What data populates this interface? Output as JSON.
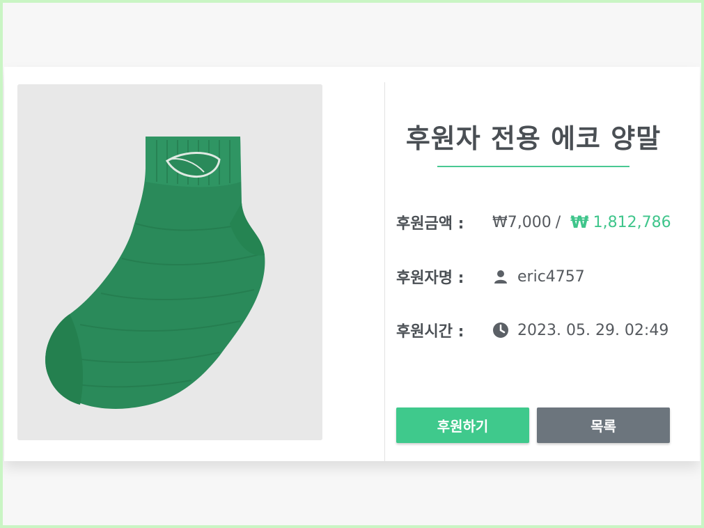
{
  "product": {
    "title": "후원자 전용 에코 양말",
    "image_icon": "green-ankle-sock-image"
  },
  "details": {
    "amount_label": "후원금액 :",
    "amount_value": "₩7,000",
    "amount_sep": "/",
    "total_icon": "won-icon",
    "total_symbol": "₩",
    "total_value": "1,812,786",
    "name_label": "후원자명 :",
    "name_icon": "user-icon",
    "name_value": "eric4757",
    "time_label": "후원시간 :",
    "time_icon": "clock-icon",
    "time_value": "2023. 05. 29. 02:49"
  },
  "actions": {
    "donate_label": "후원하기",
    "list_label": "목록"
  },
  "colors": {
    "accent": "#3fc98c",
    "secondary": "#6c757d",
    "text": "#4a4f54"
  }
}
